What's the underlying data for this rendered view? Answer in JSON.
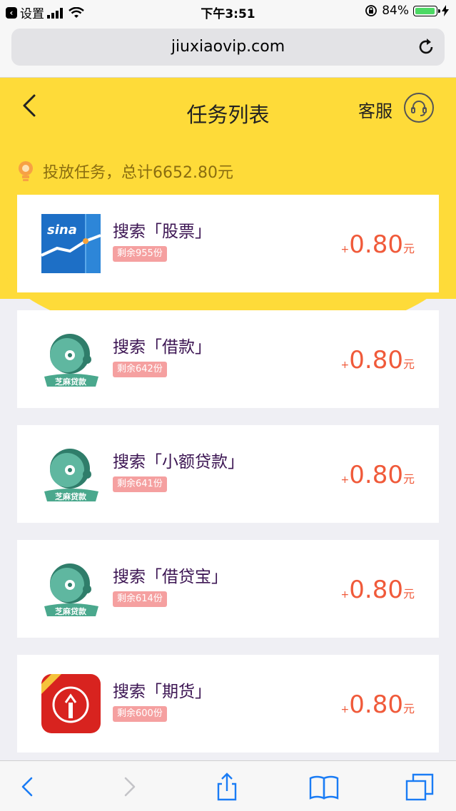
{
  "status_bar": {
    "back_app": "设置",
    "time": "下午3:51",
    "battery": "84%"
  },
  "browser": {
    "url": "jiuxiaovip.com"
  },
  "header": {
    "title": "任务列表",
    "service_label": "客服"
  },
  "summary": {
    "text": "投放任务，总计6652.80元"
  },
  "tasks": [
    {
      "title": "搜索「股票」",
      "remaining": "剩余955份",
      "plus": "+",
      "amount": "0.80",
      "unit": "元",
      "logo": "sina-finance-icon"
    },
    {
      "title": "搜索「借款」",
      "remaining": "剩余642份",
      "plus": "+",
      "amount": "0.80",
      "unit": "元",
      "logo": "zhima-daikuan-icon",
      "logo_text": "芝麻贷款"
    },
    {
      "title": "搜索「小额贷款」",
      "remaining": "剩余641份",
      "plus": "+",
      "amount": "0.80",
      "unit": "元",
      "logo": "zhima-daikuan-icon",
      "logo_text": "芝麻贷款"
    },
    {
      "title": "搜索「借贷宝」",
      "remaining": "剩余614份",
      "plus": "+",
      "amount": "0.80",
      "unit": "元",
      "logo": "zhima-daikuan-icon",
      "logo_text": "芝麻贷款"
    },
    {
      "title": "搜索「期货」",
      "remaining": "剩余600份",
      "plus": "+",
      "amount": "0.80",
      "unit": "元",
      "logo": "futures-app-icon"
    }
  ],
  "colors": {
    "header_yellow": "#fedb39",
    "price_red": "#f05a3a",
    "badge_pink": "#f5a0a0",
    "title_purple": "#3c1553"
  }
}
